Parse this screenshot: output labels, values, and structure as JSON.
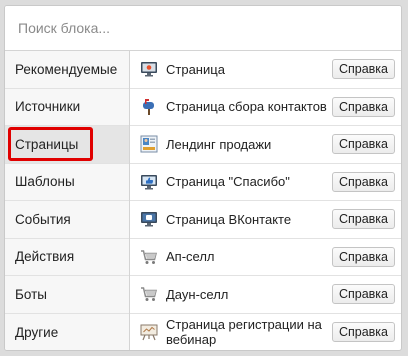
{
  "search": {
    "placeholder": "Поиск блока..."
  },
  "categories": [
    {
      "label": "Рекомендуемые"
    },
    {
      "label": "Источники"
    },
    {
      "label": "Страницы"
    },
    {
      "label": "Шаблоны"
    },
    {
      "label": "События"
    },
    {
      "label": "Действия"
    },
    {
      "label": "Боты"
    },
    {
      "label": "Другие"
    }
  ],
  "active_category": "Страницы",
  "blocks": [
    {
      "name": "Страница",
      "icon": "monitor-icon",
      "help": "Справка"
    },
    {
      "name": "Страница сбора контактов",
      "icon": "mailbox-icon",
      "help": "Справка"
    },
    {
      "name": "Лендинг продажи",
      "icon": "landing-page-icon",
      "help": "Справка"
    },
    {
      "name": "Страница \"Спасибо\"",
      "icon": "thumbs-up-icon",
      "help": "Справка"
    },
    {
      "name": "Страница ВКонтакте",
      "icon": "vk-page-icon",
      "help": "Справка"
    },
    {
      "name": "Ап-селл",
      "icon": "cart-icon",
      "help": "Справка"
    },
    {
      "name": "Даун-селл",
      "icon": "cart-icon",
      "help": "Справка"
    },
    {
      "name": "Страница регистрации на вебинар",
      "icon": "webinar-board-icon",
      "help": "Справка"
    }
  ],
  "colors": {
    "highlight": "#e00000",
    "active_bg": "#e5e5e5"
  }
}
